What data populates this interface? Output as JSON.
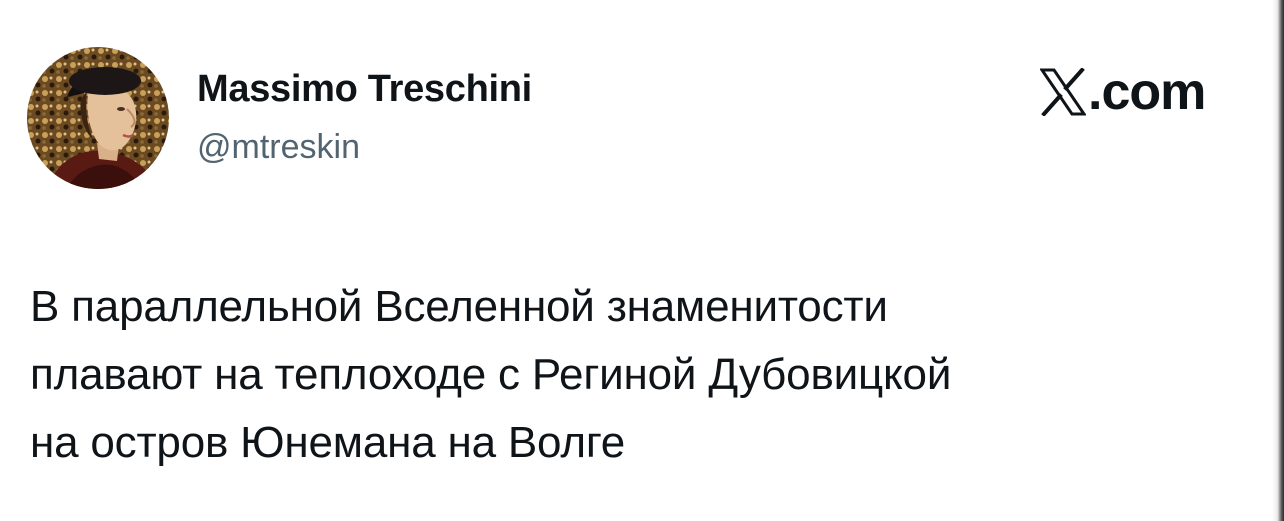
{
  "author": {
    "name": "Massimo Treschini",
    "handle": "@mtreskin"
  },
  "brand": {
    "suffix": ".com"
  },
  "tweet": {
    "lines": [
      "В параллельной Вселенной знаменитости",
      "плавают на теплоходе с Региной Дубовицкой",
      "на остров Юнемана на Волге"
    ]
  },
  "colors": {
    "text_primary": "#0f1419",
    "text_secondary": "#536471",
    "background": "#ffffff"
  },
  "icons": {
    "avatar": "profile-portrait",
    "brand": "x-logo-icon"
  }
}
